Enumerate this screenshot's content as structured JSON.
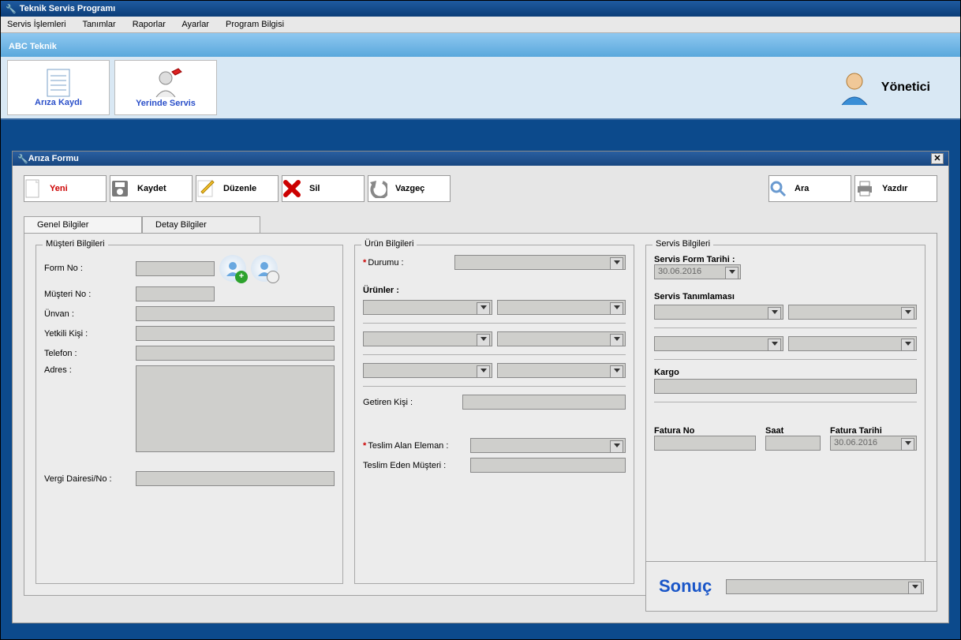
{
  "window": {
    "title": "Teknik Servis Programı"
  },
  "menubar": {
    "items": [
      "Servis İşlemleri",
      "Tanımlar",
      "Raporlar",
      "Ayarlar",
      "Program Bilgisi"
    ]
  },
  "banner": {
    "company": "ABC Teknik"
  },
  "ribbon": {
    "btn_ariza": "Arıza Kaydı",
    "btn_yerinde": "Yerinde Servis",
    "user_role": "Yönetici"
  },
  "form": {
    "title": "Arıza Formu",
    "toolbar": {
      "yeni": "Yeni",
      "kaydet": "Kaydet",
      "duzenle": "Düzenle",
      "sil": "Sil",
      "vazgec": "Vazgeç",
      "ara": "Ara",
      "yazdir": "Yazdır"
    },
    "tabs": {
      "genel": "Genel Bilgiler",
      "detay": "Detay Bilgiler"
    },
    "customer": {
      "legend": "Müşteri Bilgileri",
      "form_no_label": "Form No :",
      "musteri_no_label": "Müşteri No :",
      "unvan_label": "Ünvan :",
      "yetkili_label": "Yetkili Kişi :",
      "telefon_label": "Telefon :",
      "adres_label": "Adres :",
      "vergi_label": "Vergi Dairesi/No :",
      "form_no": "",
      "musteri_no": "",
      "unvan": "",
      "yetkili": "",
      "telefon": "",
      "adres": "",
      "vergi": ""
    },
    "product": {
      "legend": "Ürün Bilgileri",
      "durumu_label": "Durumu :",
      "urunler_label": "Ürünler :",
      "getiren_label": "Getiren Kişi :",
      "teslim_alan_label": "Teslim Alan Eleman :",
      "teslim_eden_label": "Teslim Eden Müşteri :",
      "durumu": "",
      "getiren": "",
      "teslim_alan": "",
      "teslim_eden": ""
    },
    "service": {
      "legend": "Servis Bilgileri",
      "form_tarihi_label": "Servis Form Tarihi :",
      "form_tarihi": "30.06.2016",
      "tanimlama_label": "Servis Tanımlaması",
      "kargo_label": "Kargo",
      "fatura_no_label": "Fatura No",
      "saat_label": "Saat",
      "fatura_tarihi_label": "Fatura Tarihi",
      "fatura_tarihi": "30.06.2016",
      "kargo": "",
      "fatura_no": "",
      "saat": ""
    },
    "sonuc": {
      "label": "Sonuç",
      "value": ""
    }
  }
}
